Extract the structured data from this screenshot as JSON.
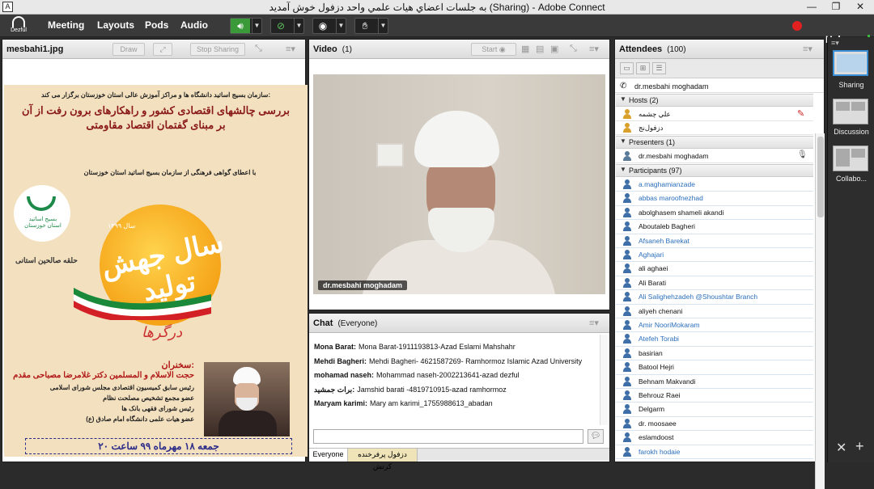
{
  "window": {
    "title": "به جلسات اعضاي هيات علمي واحد دزفول خوش آمديد (Sharing) - Adobe Connect",
    "controls": [
      "—",
      "❐",
      "✕"
    ]
  },
  "menubar": {
    "logo_text": "Dezful",
    "items": [
      "Meeting",
      "Layouts",
      "Pods",
      "Audio"
    ],
    "help": "Help"
  },
  "share_pod": {
    "title": "mesbahi1.jpg",
    "draw_label": "Draw",
    "stop_sharing_label": "Stop Sharing",
    "poster": {
      "line1": "سازمان بسیج اساتید دانشگاه ها و مراکز آموزش عالی استان خوزستان برگزار می کند:",
      "line2": "بررسی چالشهای اقتصادی کشور و راهکارهای برون رفت از آن",
      "line3": "بر مبنای گفتمان اقتصاد مقاومتی",
      "line4": "با اعطای گواهی فرهنگی از سازمان بسیج اساتید استان خوزستان",
      "emblem_text": "بسیج اساتید استان خوزستان",
      "signature": "حلقه صالحین استانی",
      "year": "سال ۱۳۹۹",
      "big_text": "سال جهش تولید",
      "script": "درگرها",
      "speaker_label": "سخنران:",
      "speaker_name": "حجت الاسلام و المسلمین دکتر غلامرضا مصباحی مقدم",
      "bio": [
        "رئیس سابق کمیسیون اقتصادی مجلس شورای اسلامی",
        "عضو مجمع تشخیص مصلحت نظام",
        "رئیس شورای فقهی بانک ها",
        "عضو هیات علمی دانشگاه امام صادق (ع)"
      ],
      "date": "جمعه ۱۸ مهرماه ۹۹ ساعت ۲۰"
    }
  },
  "video_pod": {
    "title": "Video",
    "count": "(1)",
    "start_label": "Start",
    "camera_label": "dr.mesbahi moghadam"
  },
  "chat_pod": {
    "title": "Chat",
    "scope": "(Everyone)",
    "messages": [
      {
        "sender": "Mona Barat:",
        "text": "Mona Barat-1911193813-Azad Eslami Mahshahr"
      },
      {
        "sender": "Mehdi Bagheri:",
        "text": "Mehdi Bagheri- 4621587269- Ramhormoz Islamic Azad University"
      },
      {
        "sender": "mohamad naseh:",
        "text": "Mohammad naseh-2002213641-azad dezful"
      },
      {
        "sender": "برات جمشید:",
        "text": "Jamshid barati -4819710915-azad ramhormoz"
      },
      {
        "sender": "Maryam karimi:",
        "text": "Mary am karimi_1755988613_abadan"
      }
    ],
    "tabs": [
      "Everyone",
      "دزفول پرفرخنده کرتش"
    ]
  },
  "attendees_pod": {
    "title": "Attendees",
    "count": "(100)",
    "me": "dr.mesbahi moghadam",
    "hosts_label": "Hosts (2)",
    "hosts": [
      "علي چشمه",
      "دزفول‌نج"
    ],
    "presenters_label": "Presenters (1)",
    "presenters": [
      "dr.mesbahi moghadam"
    ],
    "participants_label": "Participants (97)",
    "participants": [
      {
        "name": "a.maghamianzade",
        "color": "#2a6ebb"
      },
      {
        "name": "abbas maroofnezhad",
        "color": "#2a6ebb"
      },
      {
        "name": "abolghasem shameli akandi",
        "color": "#111111"
      },
      {
        "name": "Aboutaleb Bagheri",
        "color": "#111111"
      },
      {
        "name": "Afsaneh Barekat",
        "color": "#2a6ebb"
      },
      {
        "name": "Aghajari",
        "color": "#2a6ebb"
      },
      {
        "name": "ali aghaei",
        "color": "#111111"
      },
      {
        "name": "Ali Barati",
        "color": "#111111"
      },
      {
        "name": "Ali Salighehzadeh @Shoushtar Branch",
        "color": "#2a6ebb"
      },
      {
        "name": "aliyeh chenani",
        "color": "#111111"
      },
      {
        "name": "Amir NooriMokaram",
        "color": "#2a6ebb"
      },
      {
        "name": "Atefeh Torabi",
        "color": "#2a6ebb"
      },
      {
        "name": "basirian",
        "color": "#111111"
      },
      {
        "name": "Batool Hejri",
        "color": "#111111"
      },
      {
        "name": "Behnam Makvandi",
        "color": "#111111"
      },
      {
        "name": "Behrouz Raei",
        "color": "#111111"
      },
      {
        "name": "Delgarm",
        "color": "#111111"
      },
      {
        "name": "dr. moosaee",
        "color": "#111111"
      },
      {
        "name": "eslamdoost",
        "color": "#111111"
      },
      {
        "name": "farokh hodaie",
        "color": "#2a6ebb"
      }
    ]
  },
  "layouts_panel": {
    "items": [
      "Sharing",
      "Discussion",
      "Collabo..."
    ]
  },
  "colors": {
    "accent": "#3b8fd6",
    "record": "#e12020",
    "signal": "#3db83d"
  }
}
